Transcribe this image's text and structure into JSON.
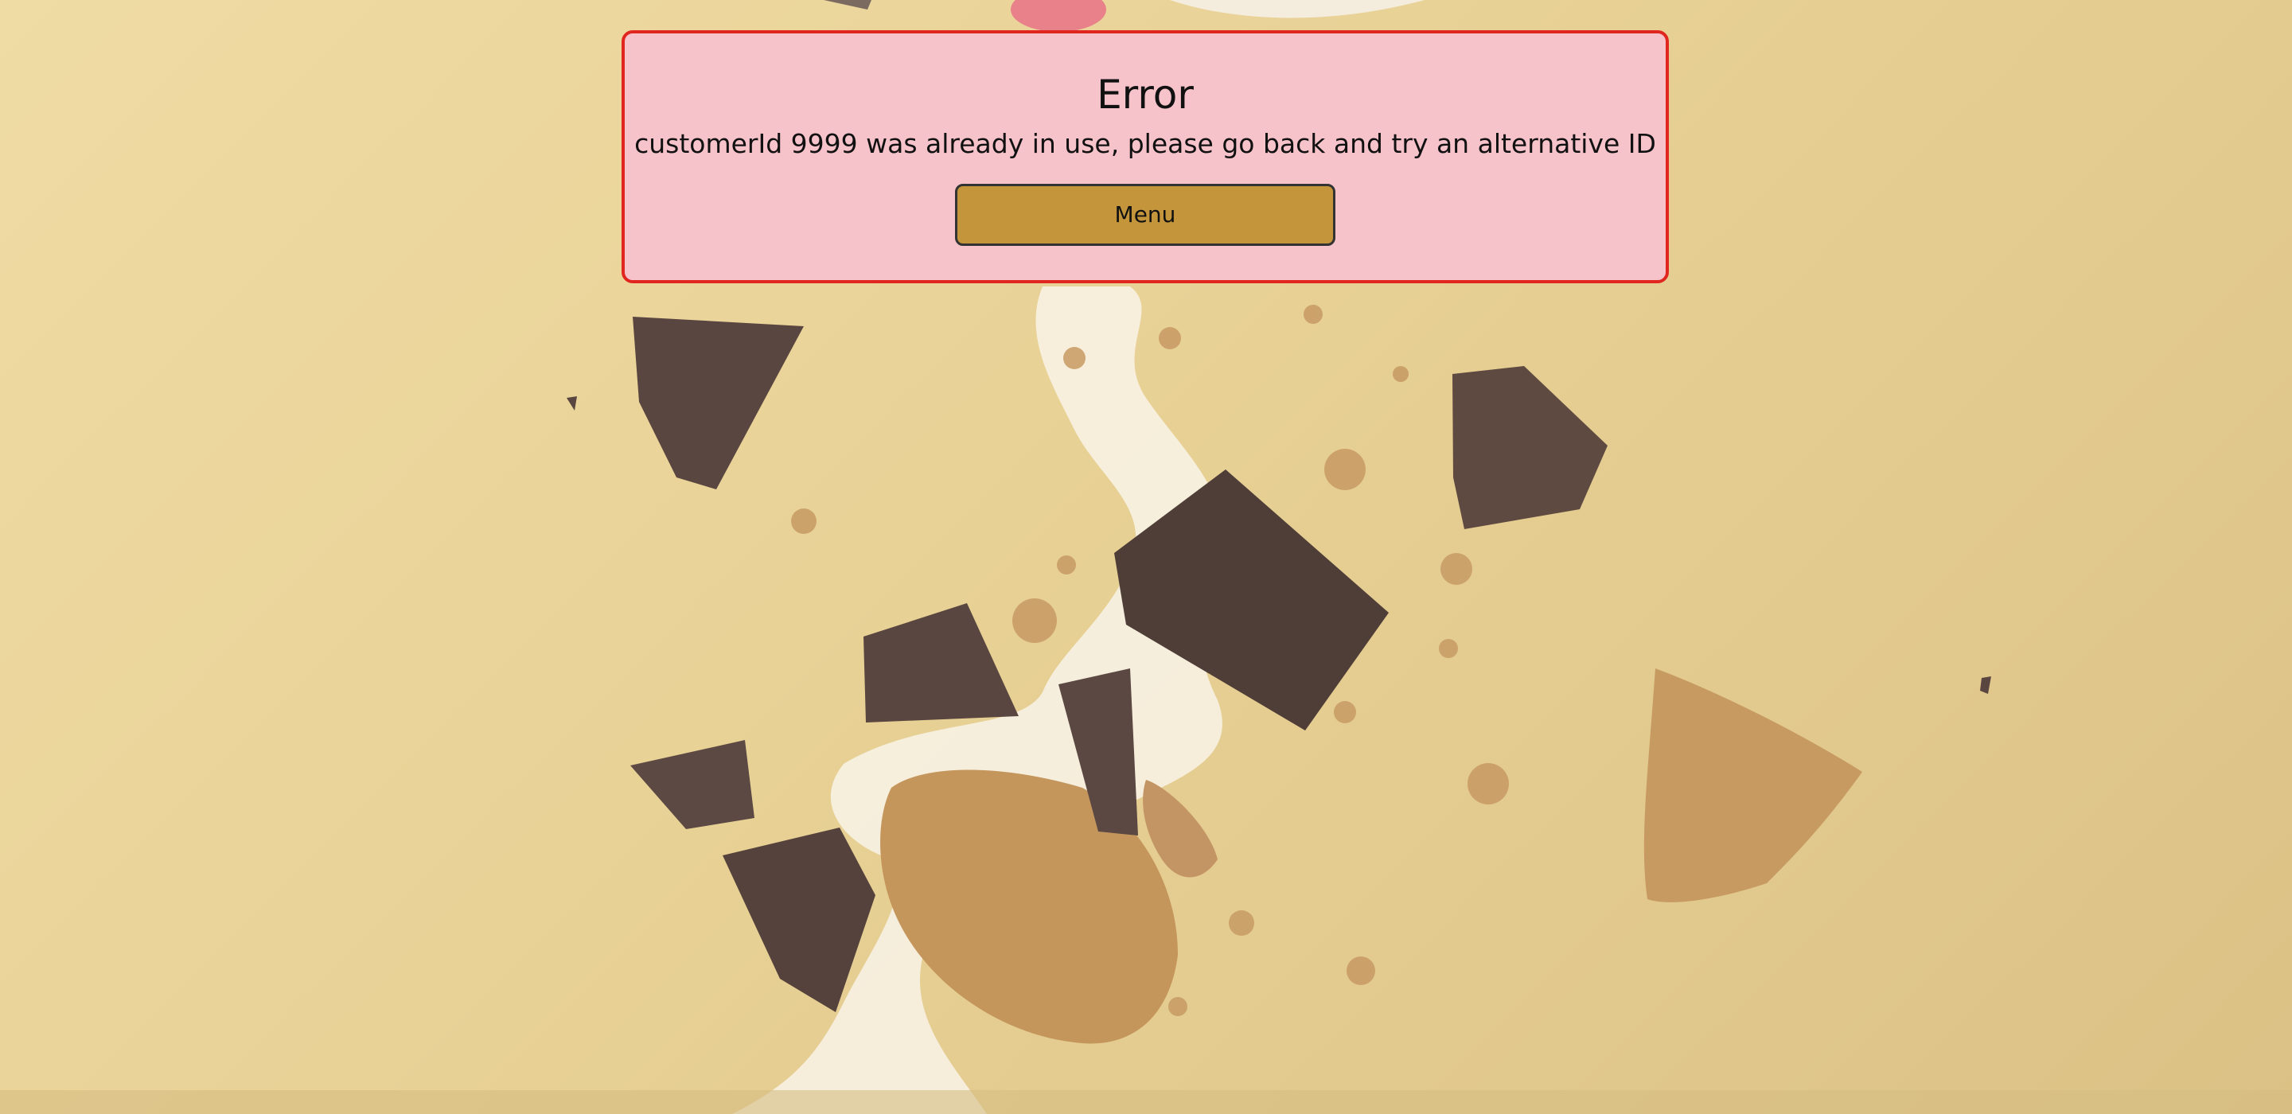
{
  "error": {
    "title": "Error",
    "message": "customerId 9999 was already in use, please go back and try an alternative ID",
    "menu_button_label": "Menu"
  },
  "colors": {
    "background": "#e8d195",
    "card_background": "#f6c3cb",
    "card_border": "#e0261f",
    "button_background": "#c4953b"
  }
}
